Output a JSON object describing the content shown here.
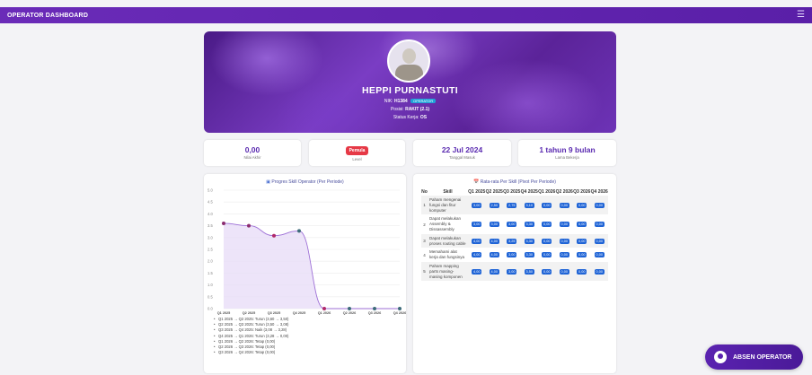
{
  "header": {
    "title": "OPERATOR DASHBOARD",
    "menu_icon": "hamburger-icon"
  },
  "profile": {
    "name": "HEPPI PURNASTUTI",
    "nik_label": "NIK:",
    "nik": "H1384",
    "role_tag": "OPERATOR",
    "posisi_label": "Posisi:",
    "posisi": "RAKIT (2.1)",
    "status_label": "Status Kerja:",
    "status": "OS"
  },
  "stats": [
    {
      "value": "0,00",
      "label": "Nilai Akhir"
    },
    {
      "value": "Pemula",
      "label": "Level"
    },
    {
      "value": "22 Jul 2024",
      "label": "Tanggal Masuk"
    },
    {
      "value": "1 tahun 9 bulan",
      "label": "Lama Bekerja"
    }
  ],
  "chart_card": {
    "title": "Progres Skill Operator (Per Periode)",
    "legend": [
      "Q1 2025 → Q2 2025: Turun (3,60 → 3,50)",
      "Q2 2025 → Q3 2025: Turun (3,50 → 3,08)",
      "Q3 2025 → Q4 2025: Naik (3,08 → 3,28)",
      "Q4 2025 → Q1 2026: Turun (3,28 → 0,00)",
      "Q1 2026 → Q2 2026: Tetap (0,00)",
      "Q2 2026 → Q3 2026: Tetap (0,00)",
      "Q3 2026 → Q4 2026: Tetap (0,00)"
    ]
  },
  "chart_data": {
    "type": "area",
    "categories": [
      "Q1 2025",
      "Q2 2025",
      "Q3 2025",
      "Q4 2025",
      "Q1 2026",
      "Q2 2026",
      "Q3 2026",
      "Q4 2026"
    ],
    "values": [
      3.6,
      3.5,
      3.08,
      3.28,
      0,
      0,
      0,
      0
    ],
    "point_colors": [
      "#8b2c6f",
      "#8b2c6f",
      "#b0286a",
      "#3d6b7a",
      "#b0286a",
      "#3d6b7a",
      "#3d6b7a",
      "#3d6b7a"
    ],
    "yticks": [
      "0.0",
      "0.5",
      "1.0",
      "1.5",
      "2.0",
      "2.5",
      "3.0",
      "3.5",
      "4.0",
      "4.5",
      "5.0"
    ],
    "ylim": [
      0,
      5
    ],
    "grid": true,
    "line_color": "#9d6fd6",
    "fill_color": "#e9ddf7"
  },
  "table_card": {
    "title": "Rata-rata Per Skill (Pivot Per Periode)",
    "headers": [
      "No",
      "Skill",
      "Q1 2025",
      "Q2 2025",
      "Q3 2025",
      "Q4 2025",
      "Q1 2026",
      "Q2 2026",
      "Q3 2026",
      "Q4 2026"
    ],
    "rows": [
      {
        "no": "1",
        "skill": "Paham mengenai fungsi dan fitur komputer",
        "values": [
          "3,00",
          "2,50",
          "2,75",
          "3,10",
          "0,00",
          "0,00",
          "0,00",
          "0,00"
        ]
      },
      {
        "no": "2",
        "skill": "Dapat melakukan Assembly & Dissassembly",
        "values": [
          "3,00",
          "3,00",
          "3,00",
          "3,30",
          "0,00",
          "0,00",
          "0,00",
          "0,00"
        ]
      },
      {
        "no": "3",
        "skill": "Dapat melakukan proses routing cable",
        "values": [
          "4,00",
          "4,00",
          "3,25",
          "3,30",
          "0,00",
          "0,00",
          "0,00",
          "0,00"
        ]
      },
      {
        "no": "4",
        "skill": "Memahami alat kerja dan fungsinya",
        "values": [
          "4,00",
          "4,00",
          "3,00",
          "3,30",
          "0,00",
          "0,00",
          "0,00",
          "0,00"
        ]
      },
      {
        "no": "5",
        "skill": "Paham mapping parts masing-masing komponen",
        "values": [
          "4,00",
          "4,00",
          "3,00",
          "3,50",
          "0,00",
          "0,00",
          "0,00",
          "0,00"
        ]
      }
    ]
  },
  "actions": {
    "absen_label": "ABSEN OPERATOR"
  },
  "colors": {
    "brand": "#6a2bb8",
    "pill": "#1f64d6",
    "badge": "#e63946",
    "accent_text": "#5a2ab0"
  }
}
